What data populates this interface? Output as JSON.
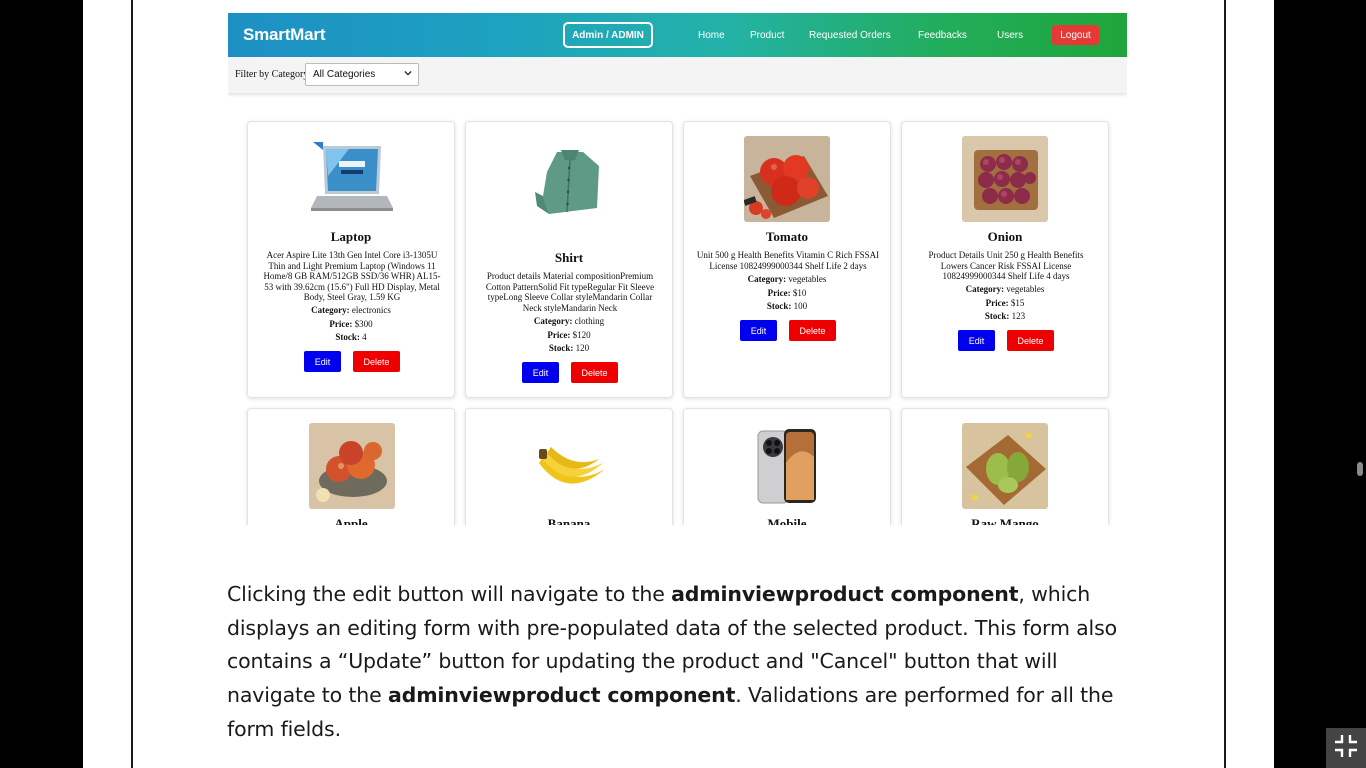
{
  "navbar": {
    "brand": "SmartMart",
    "admin_label": "Admin / ADMIN",
    "links": [
      "Home",
      "Product",
      "Requested Orders",
      "Feedbacks",
      "Users"
    ],
    "logout_label": "Logout"
  },
  "filter": {
    "label": "Filter by Category:",
    "selected": "All Categories"
  },
  "labels": {
    "category": "Category:",
    "price": "Price:",
    "stock": "Stock:",
    "edit": "Edit",
    "delete": "Delete"
  },
  "products": [
    {
      "name": "Laptop",
      "description": "Acer Aspire Lite 13th Gen Intel Core i3-1305U Thin and Light Premium Laptop (Windows 11 Home/8 GB RAM/512GB SSD/36 WHR) AL15-53 with 39.62cm (15.6\") Full HD Display, Metal Body, Steel Gray, 1.59 KG",
      "category": "electronics",
      "price": "$300",
      "stock": "4"
    },
    {
      "name": "Shirt",
      "description": "Product details Material compositionPremium Cotton PatternSolid Fit typeRegular Fit Sleeve typeLong Sleeve Collar styleMandarin Collar Neck styleMandarin Neck",
      "category": "clothing",
      "price": "$120",
      "stock": "120"
    },
    {
      "name": "Tomato",
      "description": "Unit 500 g Health Benefits Vitamin C Rich FSSAI License 10824999000344 Shelf Life 2 days",
      "category": "vegetables",
      "price": "$10",
      "stock": "100"
    },
    {
      "name": "Onion",
      "description": "Product Details Unit 250 g Health Benefits Lowers Cancer Risk FSSAI License 10824999000344 Shelf Life 4 days",
      "category": "vegetables",
      "price": "$15",
      "stock": "123"
    },
    {
      "name": "Apple"
    },
    {
      "name": "Banana"
    },
    {
      "name": "Mobile"
    },
    {
      "name": "Raw Mango"
    }
  ],
  "article": {
    "p1": "Clicking the edit button will navigate to the ",
    "b1": "adminviewproduct component",
    "p2": ", which displays an editing form with pre-populated data of the selected product. This form also contains a “Update” button for updating the product and \"Cancel\" button that will navigate to the ",
    "b2": "adminviewproduct component",
    "p3": ". Validations are performed for all the form fields."
  },
  "icons": {
    "exit_fullscreen": "exit-fullscreen-icon",
    "select_chevron": "chevron-down-icon"
  },
  "colors": {
    "nav_gradient_start": "#1d8fc4",
    "nav_gradient_end": "#1fa53a",
    "edit_button": "#0000ee",
    "delete_button": "#ee0000",
    "logout_button": "#e53935"
  }
}
